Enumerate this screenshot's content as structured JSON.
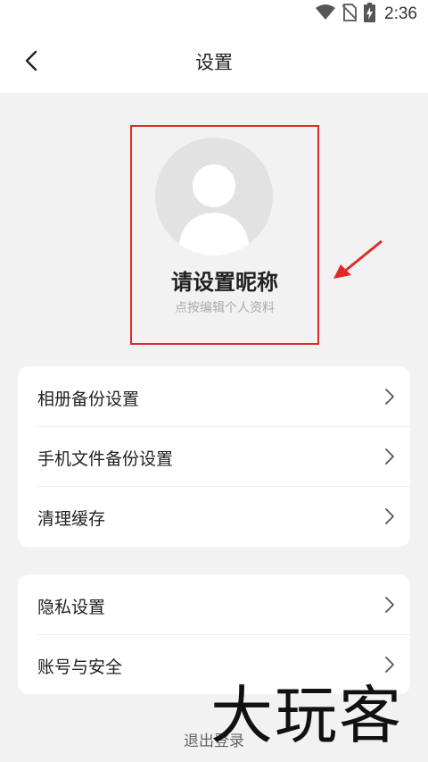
{
  "status_bar": {
    "time": "2:36",
    "icons": [
      "wifi-icon",
      "no-sim-icon",
      "battery-charging-icon"
    ]
  },
  "header": {
    "back_icon": "chevron-left-icon",
    "title": "设置"
  },
  "profile": {
    "avatar_icon": "default-avatar-icon",
    "nickname": "请设置昵称",
    "hint": "点按编辑个人资料",
    "highlight_color": "#e02a2a"
  },
  "settings_group_1": {
    "items": [
      {
        "label": "相册备份设置",
        "icon": "chevron-right-icon"
      },
      {
        "label": "手机文件备份设置",
        "icon": "chevron-right-icon"
      },
      {
        "label": "清理缓存",
        "icon": "chevron-right-icon"
      }
    ]
  },
  "settings_group_2": {
    "items": [
      {
        "label": "隐私设置",
        "icon": "chevron-right-icon"
      },
      {
        "label": "账号与安全",
        "icon": "chevron-right-icon"
      }
    ]
  },
  "footer": {
    "logout_label": "退出登录"
  },
  "watermark": {
    "text": "大玩客"
  }
}
